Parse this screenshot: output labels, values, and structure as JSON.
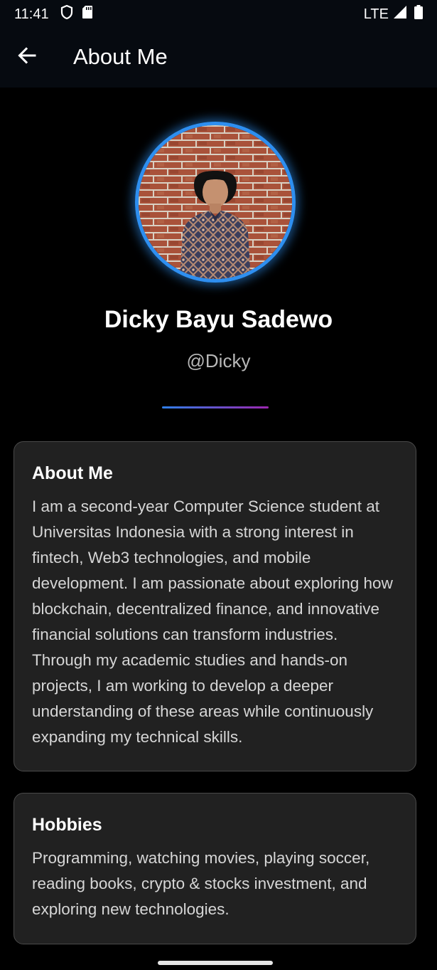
{
  "status_bar": {
    "time": "11:41",
    "network": "LTE"
  },
  "app_bar": {
    "title": "About Me"
  },
  "profile": {
    "name": "Dicky Bayu Sadewo",
    "handle": "@Dicky"
  },
  "about_card": {
    "title": "About Me",
    "body": "I am a second-year Computer Science student at Universitas Indonesia with a strong interest in fintech, Web3 technologies, and mobile development. I am passionate about exploring how blockchain, decentralized finance, and innovative financial solutions can transform industries. Through my academic studies and hands-on projects, I am working to develop a deeper understanding of these areas while continuously expanding my technical skills."
  },
  "hobbies_card": {
    "title": "Hobbies",
    "body": "Programming, watching movies, playing soccer, reading books, crypto & stocks investment, and exploring new technologies."
  },
  "colors": {
    "background": "#000000",
    "app_bar": "#060a10",
    "card": "#212121",
    "avatar_ring": "#2e8ff0",
    "divider_start": "#2f7fe8",
    "divider_end": "#9c27b0"
  },
  "icons": {
    "back": "arrow-left-icon",
    "vpn": "shield-icon",
    "sd": "sd-card-icon",
    "signal": "signal-icon",
    "battery": "battery-icon"
  }
}
